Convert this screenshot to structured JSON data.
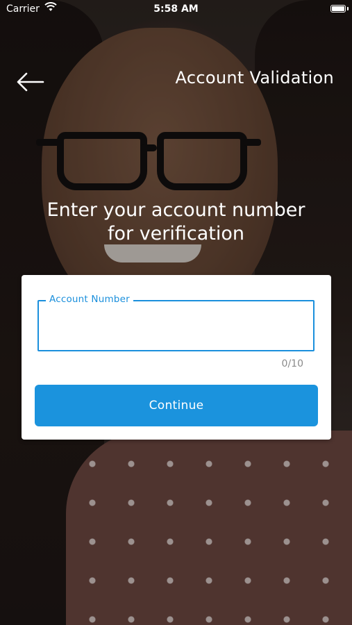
{
  "status_bar": {
    "carrier": "Carrier",
    "time": "5:58 AM",
    "wifi_icon": "wifi-icon",
    "battery_icon": "battery-icon"
  },
  "nav": {
    "back_icon": "arrow-left-icon",
    "title": "Account Validation"
  },
  "prompt": {
    "line1": "Enter your account number",
    "line2": "for verification"
  },
  "form": {
    "account_field": {
      "label": "Account Number",
      "value": "",
      "counter": "0/10"
    },
    "continue_label": "Continue"
  },
  "colors": {
    "accent": "#1b93dd",
    "field_border": "#1a8fdc",
    "counter_text": "#8a8a8a"
  }
}
